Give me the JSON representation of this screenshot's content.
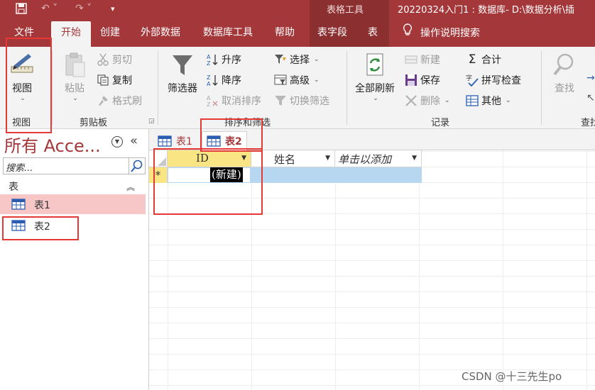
{
  "titlebar": {
    "context_title": "表格工具",
    "doc_title": "20220324入门1 : 数据库- D:\\数据分析\\插"
  },
  "tabs": [
    {
      "label": "文件"
    },
    {
      "label": "开始"
    },
    {
      "label": "创建"
    },
    {
      "label": "外部数据"
    },
    {
      "label": "数据库工具"
    },
    {
      "label": "帮助"
    },
    {
      "label": "表字段"
    },
    {
      "label": "表"
    }
  ],
  "tellme": "操作说明搜索",
  "ribbon": {
    "view": {
      "button": "视图",
      "group": "视图"
    },
    "clipboard": {
      "paste": "粘贴",
      "cut": "剪切",
      "copy": "复制",
      "format_painter": "格式刷",
      "group": "剪贴板"
    },
    "sort": {
      "filter": "筛选器",
      "asc": "升序",
      "desc": "降序",
      "clear": "取消排序",
      "select": "选择",
      "advanced": "高级",
      "toggle": "切换筛选",
      "group": "排序和筛选"
    },
    "records": {
      "refresh": "全部刷新",
      "new": "新建",
      "save": "保存",
      "delete": "删除",
      "total": "合计",
      "spell": "拼写检查",
      "more": "其他",
      "group": "记录"
    },
    "find": {
      "find": "查找",
      "group": "查找"
    }
  },
  "nav": {
    "title": "所有 Acce...",
    "search_placeholder": "搜索...",
    "group": "表",
    "items": [
      {
        "label": "表1"
      },
      {
        "label": "表2"
      }
    ]
  },
  "doc_tabs": [
    {
      "label": "表1"
    },
    {
      "label": "表2"
    }
  ],
  "datasheet": {
    "columns": [
      {
        "label": "ID"
      },
      {
        "label": "姓名"
      },
      {
        "label": "单击以添加"
      }
    ],
    "new_row_marker": "*",
    "new_value": "(新建)"
  },
  "watermark": "CSDN @十三先生po",
  "colors": {
    "accent": "#a4373a",
    "highlight": "#f9e583",
    "annotation": "#e53935"
  }
}
